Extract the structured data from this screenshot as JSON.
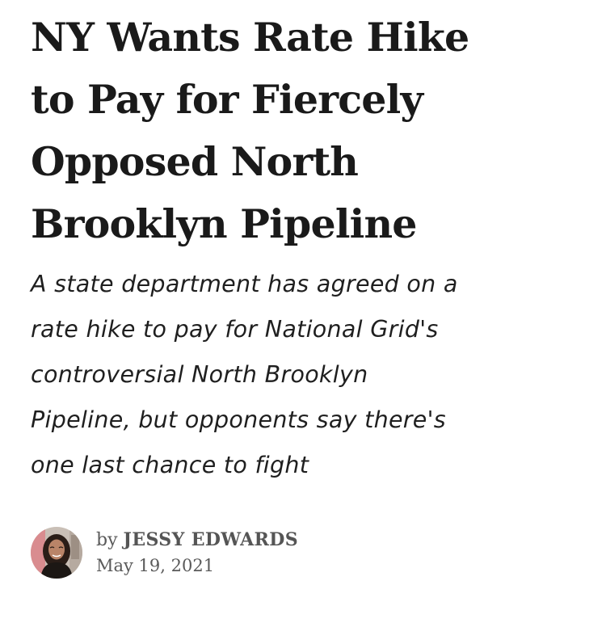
{
  "article": {
    "headline_lines": [
      "NY Wants Rate Hike",
      "to Pay for Fiercely",
      "Opposed North",
      "Brooklyn Pipeline"
    ],
    "subhead_lines": [
      "A state department has agreed on a",
      "rate hike to pay for National Grid's",
      "controversial North Brooklyn",
      "Pipeline, but opponents say there's",
      "one last chance to fight"
    ],
    "byline": {
      "prefix": "by",
      "author": "JESSY EDWARDS",
      "date": "May 19, 2021"
    }
  },
  "colors": {
    "headline": "#1a1a1a",
    "subhead": "#1f1f1f",
    "byline": "#555555",
    "background": "#ffffff"
  }
}
